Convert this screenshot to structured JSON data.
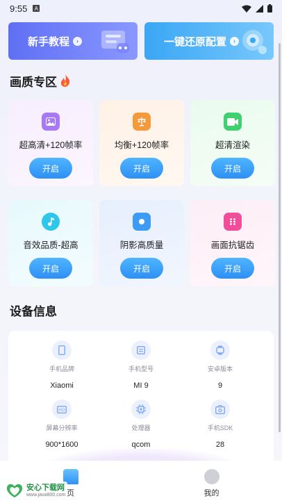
{
  "status_bar": {
    "time": "9:55"
  },
  "banners": [
    {
      "label": "新手教程",
      "color": "#6b78f3"
    },
    {
      "label": "一键还原配置",
      "color": "#4aaef6"
    }
  ],
  "quality": {
    "title": "画质专区",
    "cards": [
      {
        "label": "超高清+120帧率",
        "button": "开启",
        "icon": "image-icon",
        "color": "#a779f2"
      },
      {
        "label": "均衡+120帧率",
        "button": "开启",
        "icon": "scale-icon",
        "color": "#f59a3a"
      },
      {
        "label": "超清渲染",
        "button": "开启",
        "icon": "video-camera-icon",
        "color": "#3fd06f"
      },
      {
        "label": "音效品质-超高",
        "button": "开启",
        "icon": "music-note-icon",
        "color": "#2cc7e9"
      },
      {
        "label": "阴影高质量",
        "button": "开启",
        "icon": "shadow-icon",
        "color": "#3d9bf5"
      },
      {
        "label": "画面抗锯齿",
        "button": "开启",
        "icon": "dice-icon",
        "color": "#f04e9b"
      }
    ]
  },
  "device": {
    "title": "设备信息",
    "items": [
      {
        "label": "手机品牌",
        "value": "Xiaomi",
        "icon": "phone-icon"
      },
      {
        "label": "手机型号",
        "value": "MI 9",
        "icon": "model-icon"
      },
      {
        "label": "安卓版本",
        "value": "9",
        "icon": "android-icon"
      },
      {
        "label": "屏幕分辨率",
        "value": "900*1600",
        "icon": "hd-icon"
      },
      {
        "label": "处理器",
        "value": "qcom",
        "icon": "chip-icon"
      },
      {
        "label": "手机SDK",
        "value": "28",
        "icon": "sdk-icon"
      }
    ]
  },
  "tabbar": {
    "home_label": "页",
    "me_label": "我的"
  },
  "watermark": {
    "main": "安心下载网",
    "sub": "www.java800.com"
  }
}
